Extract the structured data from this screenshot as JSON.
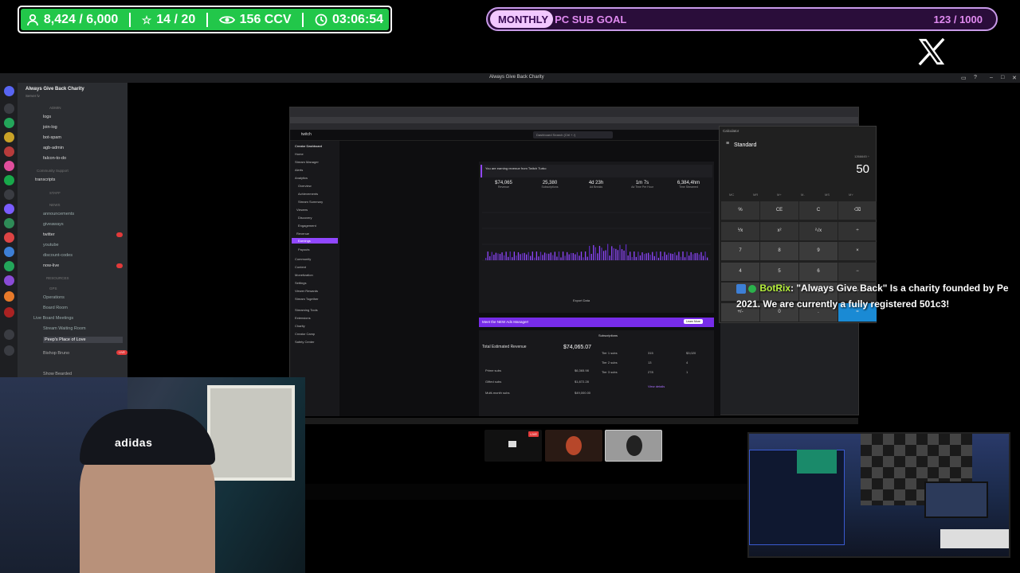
{
  "overlay": {
    "stats": {
      "followers": "8,424 / 6,000",
      "subs": "14 / 20",
      "viewers": "156 CCV",
      "timer": "03:06:54",
      "icons": [
        "person-icon",
        "star-icon",
        "eye-icon",
        "clock-icon"
      ]
    },
    "goal": {
      "pill": "MONTHLY",
      "title": "PC SUB GOAL",
      "count": "123 / 1000",
      "progress": 0.123
    },
    "social_icon": "x-logo-icon"
  },
  "discord": {
    "window_title": "Always Give Back Charity",
    "server_name": "Always Give Back Charity",
    "server_sub": "Server lv",
    "categories": [
      "ADMIN",
      "Community Support",
      "STAFF",
      "NEWS",
      "RESOURCES",
      "GPS"
    ],
    "channels": [
      {
        "name": "logs"
      },
      {
        "name": "join-log"
      },
      {
        "name": "bot-spam"
      },
      {
        "name": "agb-admin"
      },
      {
        "name": "falcon-to-do"
      },
      {
        "name": "transcripts"
      },
      {
        "name": "announcements"
      },
      {
        "name": "giveaways"
      },
      {
        "name": "twitter",
        "badge": "69"
      },
      {
        "name": "youtube"
      },
      {
        "name": "discount-codes"
      },
      {
        "name": "now-live",
        "badge": "20"
      },
      {
        "name": "Operations"
      },
      {
        "name": "Board Room"
      },
      {
        "name": "Live Board Meetings"
      },
      {
        "name": "Stream Waiting Room"
      },
      {
        "name": "Peep's Place of Love",
        "badge": "LIVE"
      },
      {
        "name": "Bishop Bruno"
      },
      {
        "name": "Show Bearded"
      }
    ]
  },
  "twitch": {
    "brand": "twitch",
    "search": "Dashboard Search (Ctrl + /)",
    "sidebar": [
      "Creator Dashboard",
      "Home",
      "Stream Manager",
      "Alerts",
      "Analytics",
      "Overview",
      "Achievements",
      "Stream Summary",
      "Viewers",
      "Discovery",
      "Engagement",
      "Revenue",
      "Earnings",
      "Payouts",
      "Community",
      "Content",
      "Monetization",
      "Settings",
      "Viewer Rewards",
      "Stream Together",
      "Streaming Tools",
      "Extensions",
      "Charity",
      "Creator Camp",
      "Safety Center"
    ],
    "banner": "You are earning revenue from Twitch Turbo",
    "kpis": [
      {
        "value": "$74,065",
        "label": "Revenue"
      },
      {
        "value": "25,380",
        "label": "Subscriptions"
      },
      {
        "value": "4d 23h",
        "label": "Ad Breaks"
      },
      {
        "value": "1m 7s",
        "label": "Ad Time Per Hour"
      },
      {
        "value": "6,384,4hm",
        "label": "Time Streamed"
      }
    ],
    "ads_banner": "Meet the NEW Ads Manager!",
    "learn_more": "Learn More",
    "total_label": "Total Estimated Revenue",
    "total_value": "$74,065.07",
    "rows": [
      {
        "label": "Prime subs",
        "value": "$6,365.98"
      },
      {
        "label": "Gifted subs",
        "value": "$1,872.28"
      },
      {
        "label": "Multi-month subs",
        "value": "$49,000.00"
      }
    ],
    "subscriptions_label": "Subscriptions",
    "tiers": [
      {
        "tier": "Tier 1 subs",
        "rev": "315",
        "sub": "$3,020"
      },
      {
        "tier": "Tier 2 subs",
        "rev": "13",
        "sub": "4"
      },
      {
        "tier": "Tier 3 subs",
        "rev": "278",
        "sub": "1"
      }
    ],
    "export": "Export Data",
    "view_details": "View details"
  },
  "calculator": {
    "app_title": "Calculator",
    "mode": "Standard",
    "expression": "1266645 ÷",
    "display": "50",
    "memory": [
      "MC",
      "MR",
      "M+",
      "M-",
      "MS",
      "M˅"
    ],
    "keys": [
      "%",
      "CE",
      "C",
      "⌫",
      "⅟x",
      "x²",
      "²√x",
      "÷",
      "7",
      "8",
      "9",
      "×",
      "4",
      "5",
      "6",
      "−",
      "1",
      "2",
      "3",
      "+",
      "+/-",
      "0",
      ".",
      "="
    ]
  },
  "chat": {
    "name": "BotRix",
    "line1": ": \"Always Give Back\" Is a charity founded by Pe",
    "line2": "2021. We are currently a fully registered 501c3!"
  },
  "video_bar": {
    "live": "LIVE"
  },
  "colors": {
    "stats_green": "#22c74a",
    "goal_purple": "#c89ae8",
    "twitch_purple": "#772ce8",
    "calc_accent": "#1a8ad4",
    "bot_green": "#b6f03c"
  }
}
